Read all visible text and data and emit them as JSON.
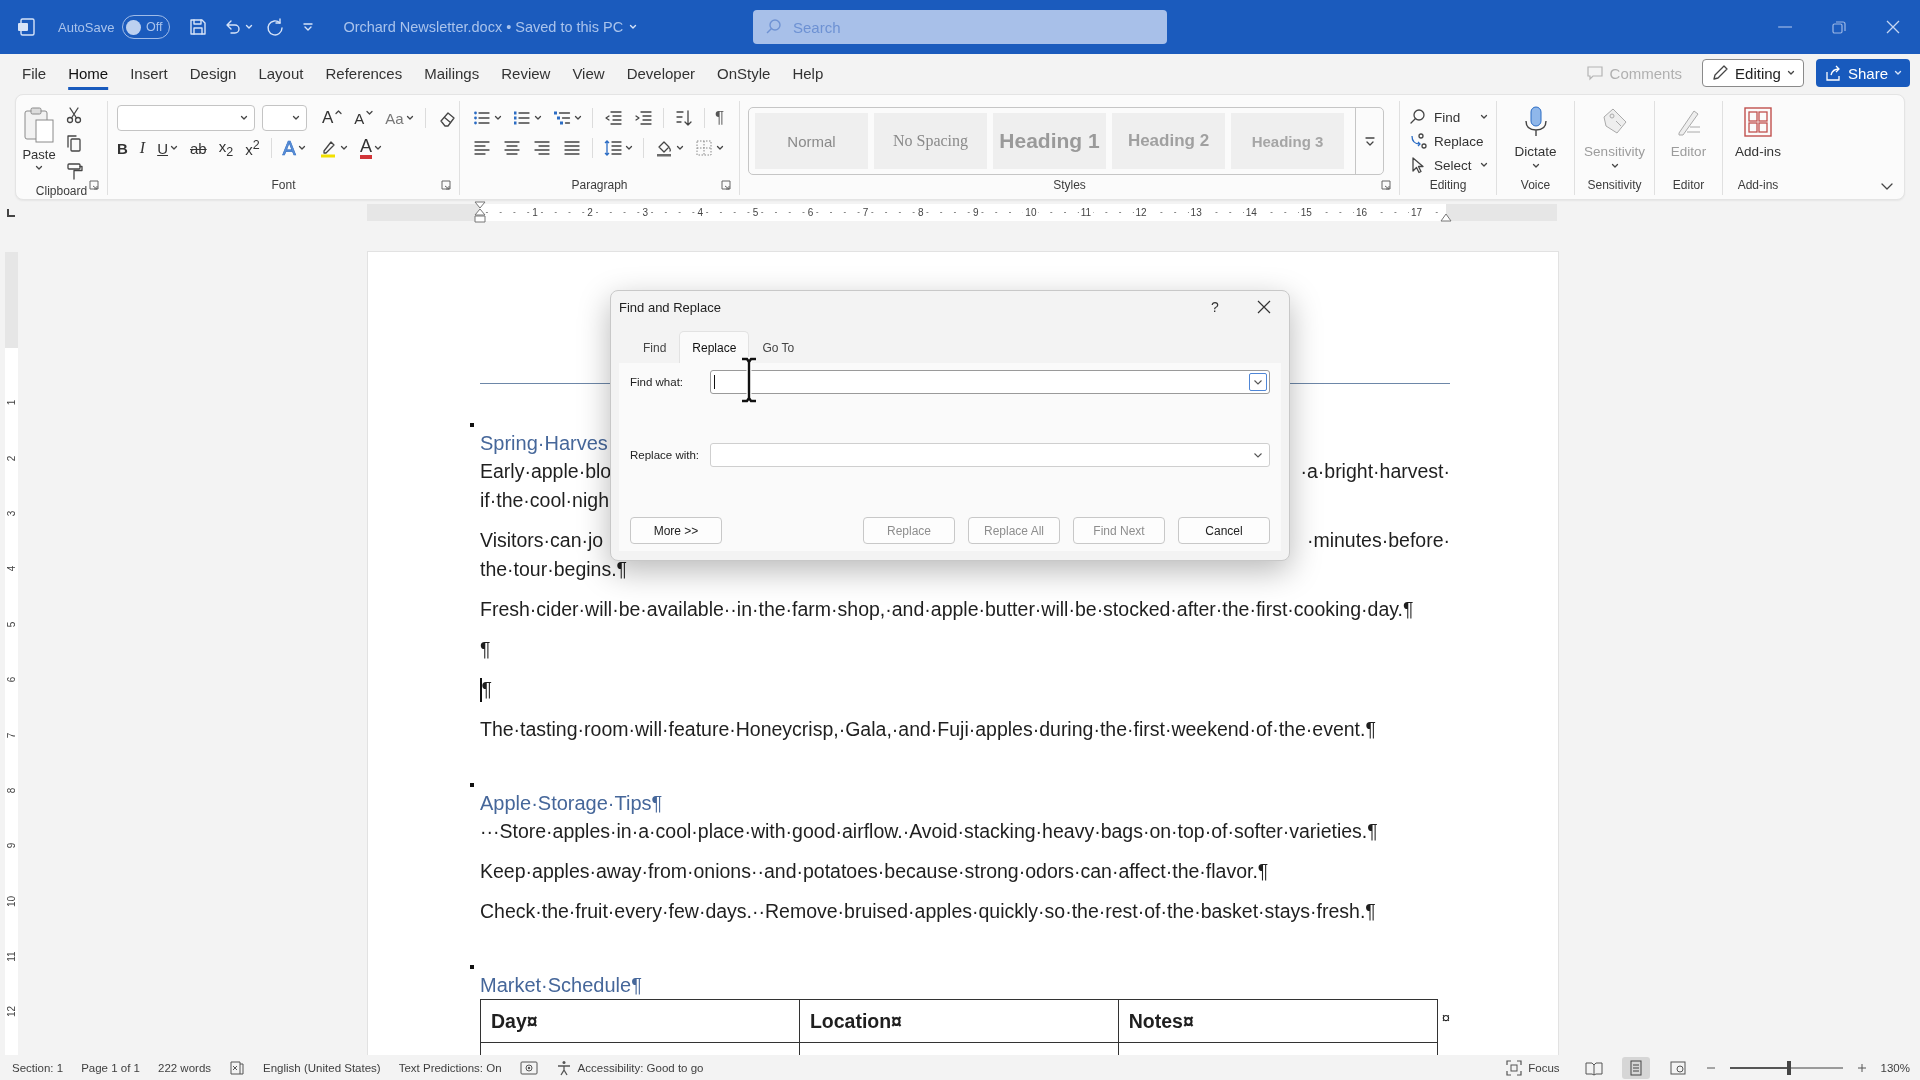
{
  "title_bar": {
    "autosave_label": "AutoSave",
    "autosave": {
      "on": false,
      "label": "Off"
    },
    "document_title": "Orchard Newsletter.docx • Saved to this PC",
    "search": {
      "placeholder": "Search"
    }
  },
  "menu_tabs": [
    {
      "label": "File",
      "selected": false
    },
    {
      "label": "Home",
      "selected": true
    },
    {
      "label": "Insert",
      "selected": false
    },
    {
      "label": "Design",
      "selected": false
    },
    {
      "label": "Layout",
      "selected": false
    },
    {
      "label": "References",
      "selected": false
    },
    {
      "label": "Mailings",
      "selected": false
    },
    {
      "label": "Review",
      "selected": false
    },
    {
      "label": "View",
      "selected": false
    },
    {
      "label": "Developer",
      "selected": false
    },
    {
      "label": "OnStyle",
      "selected": false
    },
    {
      "label": "Help",
      "selected": false
    }
  ],
  "header_buttons": [
    {
      "kind": "comments",
      "label": "Comments",
      "disabled": true
    },
    {
      "kind": "editing",
      "label": "Editing",
      "disabled": false
    },
    {
      "kind": "share",
      "label": "Share",
      "disabled": false
    }
  ],
  "ribbon": {
    "clipboard": {
      "label": "Clipboard",
      "paste": "Paste"
    },
    "font": {
      "label": "Font",
      "row_1": [
        {
          "kind": "grow",
          "label": "A"
        },
        {
          "kind": "shrink",
          "label": "A"
        },
        {
          "kind": "case",
          "label": "Aa"
        },
        {
          "kind": "clear"
        }
      ],
      "row_2": [
        {
          "kind": "bold",
          "label": "B"
        },
        {
          "kind": "italic",
          "label": "I"
        },
        {
          "kind": "underline",
          "label": "U"
        },
        {
          "kind": "strike",
          "label": "ab"
        },
        {
          "kind": "sub",
          "label": "x$_{2}$"
        },
        {
          "kind": "sup",
          "label": "x$^{2}$"
        },
        {
          "kind": "effects",
          "label": "A"
        },
        {
          "kind": "highlight"
        },
        {
          "kind": "color",
          "label": "A"
        }
      ]
    },
    "paragraph": {
      "label": "Paragraph",
      "show_marks": "¶"
    },
    "styles": {
      "label": "Styles",
      "items": [
        {
          "kind": "normal",
          "label": "Normal"
        },
        {
          "kind": "no_spacing",
          "label": "No Spacing"
        },
        {
          "kind": "heading_1",
          "label": "Heading 1"
        },
        {
          "kind": "heading_2",
          "label": "Heading 2"
        },
        {
          "kind": "heading_3",
          "label": "Heading 3"
        }
      ]
    },
    "editing": {
      "label": "Editing",
      "items": [
        {
          "kind": "find",
          "label": "Find"
        },
        {
          "kind": "replace",
          "label": "Replace"
        },
        {
          "kind": "select",
          "label": "Select"
        }
      ]
    },
    "big_groups": [
      {
        "kind": "voice",
        "label": "Voice",
        "button": "Dictate",
        "disabled": false
      },
      {
        "kind": "sensitivity",
        "label": "Sensitivity",
        "button": "Sensitivity",
        "disabled": true
      },
      {
        "kind": "editor",
        "label": "Editor",
        "button": "Editor",
        "disabled": true
      },
      {
        "kind": "addins",
        "label": "Add-ins",
        "button": "Add-ins",
        "disabled": false
      }
    ]
  },
  "ruler": {
    "numbers": [
      "1",
      "2",
      "3",
      "4",
      "5",
      "6",
      "7",
      "8",
      "9",
      "10",
      "11",
      "12",
      "13",
      "14",
      "15",
      "16",
      "17"
    ]
  },
  "vertical_ruler": {
    "numbers": [
      "1",
      "2",
      "3",
      "4",
      "5",
      "6",
      "7",
      "8",
      "9",
      "10",
      "11",
      "12"
    ]
  },
  "document": {
    "blocks": [
      {
        "kind": "heading",
        "text": "Spring·Harves"
      },
      {
        "kind": "paragraph",
        "lines": [
          {
            "text": "Early·apple·blo",
            "end": "·a·bright·harvest·",
            "cursor": false
          },
          {
            "text": "if·the·cool·nigh",
            "cursor": false
          }
        ]
      },
      {
        "kind": "paragraph",
        "lines": [
          {
            "text": "Visitors·can·jo",
            "end": "·minutes·before·",
            "cursor": false
          },
          {
            "text": "the·tour·begins.¶",
            "cursor": false
          }
        ]
      },
      {
        "kind": "paragraph",
        "lines": [
          {
            "text": "Fresh·cider·will·be·available··in·the·farm·shop,·and·apple·butter·will·be·stocked·after·the·first·cooking·day.¶",
            "cursor": false
          }
        ]
      },
      {
        "kind": "paragraph",
        "lines": [
          {
            "text": "¶",
            "cursor": false
          }
        ]
      },
      {
        "kind": "paragraph",
        "lines": [
          {
            "text": "¶",
            "cursor": true
          }
        ]
      },
      {
        "kind": "paragraph",
        "lines": [
          {
            "text": "The·tasting·room·will·feature·Honeycrisp,·Gala,·and·Fuji·apples·during·the·first·weekend·of·the·event.¶",
            "cursor": false
          }
        ]
      },
      {
        "kind": "heading",
        "text": "Apple·Storage·Tips¶"
      },
      {
        "kind": "paragraph",
        "lines": [
          {
            "text": "···Store·apples·in·a·cool·place·with·good·airflow.·Avoid·stacking·heavy·bags·on·top·of·softer·varieties.¶",
            "cursor": false
          }
        ]
      },
      {
        "kind": "paragraph",
        "lines": [
          {
            "text": "Keep·apples·away·from·onions··and·potatoes·because·strong·odors·can·affect·the·flavor.¶",
            "cursor": false
          }
        ]
      },
      {
        "kind": "paragraph",
        "lines": [
          {
            "text": "Check·the·fruit·every·few·days.··Remove·bruised·apples·quickly·so·the·rest·of·the·basket·stays·fresh.¶",
            "cursor": false
          }
        ]
      },
      {
        "kind": "heading",
        "text": "Market·Schedule¶"
      },
      {
        "kind": "table",
        "columns": [
          "Day¤",
          "Location¤",
          "Notes¤"
        ],
        "row_end": "¤"
      }
    ]
  },
  "dialog": {
    "title": "Find and Replace",
    "help": "?",
    "tabs": [
      {
        "label": "Find",
        "selected": false
      },
      {
        "label": "Replace",
        "selected": true
      },
      {
        "label": "Go To",
        "selected": false
      }
    ],
    "fields": [
      {
        "label": "Find what:",
        "focused": true
      },
      {
        "label": "Replace with:",
        "focused": false
      }
    ],
    "buttons": [
      {
        "label": "More >>",
        "disabled": false
      },
      {
        "label": "Replace",
        "disabled": true
      },
      {
        "label": "Replace All",
        "disabled": true
      },
      {
        "label": "Find Next",
        "disabled": true
      },
      {
        "label": "Cancel",
        "disabled": false
      }
    ]
  },
  "status_bar": {
    "items": [
      {
        "kind": "text",
        "label": "Section: 1"
      },
      {
        "kind": "text",
        "label": "Page 1 of 1"
      },
      {
        "kind": "text",
        "label": "222 words"
      },
      {
        "kind": "proofing"
      },
      {
        "kind": "text",
        "label": "English (United States)"
      },
      {
        "kind": "text",
        "label": "Text Predictions: On"
      },
      {
        "kind": "macro"
      },
      {
        "kind": "accessibility",
        "label": "Accessibility: Good to go"
      }
    ],
    "focus": "Focus",
    "views": [
      {
        "kind": "read",
        "selected": false
      },
      {
        "kind": "print",
        "selected": true
      },
      {
        "kind": "web",
        "selected": false
      }
    ],
    "zoom": {
      "level": 0.53,
      "label": "130%"
    }
  }
}
